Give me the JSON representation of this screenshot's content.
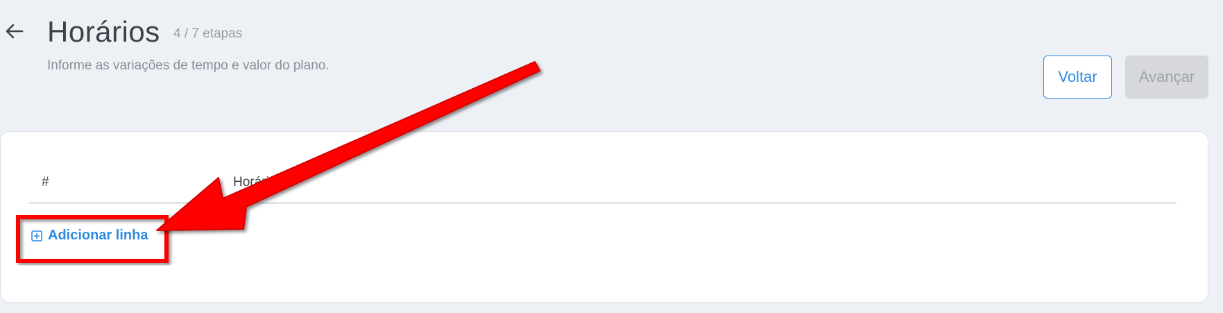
{
  "header": {
    "title": "Horários",
    "steps": "4 / 7 etapas",
    "subtitle": "Informe as variações de tempo e valor do plano."
  },
  "actions": {
    "back_label": "Voltar",
    "next_label": "Avançar"
  },
  "table": {
    "columns": [
      "#",
      "Horário"
    ],
    "add_row_label": "Adicionar linha"
  },
  "annotation": {
    "color": "#ff0000"
  }
}
